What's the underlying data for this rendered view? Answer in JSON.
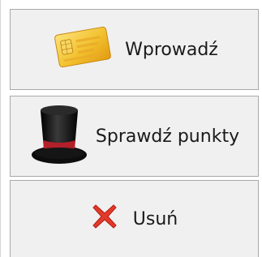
{
  "buttons": {
    "enter_label": "Wprowadź",
    "check_points_label": "Sprawdź punkty",
    "delete_label": "Usuń"
  },
  "icons": {
    "enter": "card-icon",
    "check_points": "top-hat-icon",
    "delete": "red-x-icon"
  },
  "colors": {
    "button_bg": "#f0f0f0",
    "button_border": "#a9a9a9",
    "delete_icon": "#e23a2a",
    "card_gold": "#f2c12e",
    "hat_black": "#1b1b1b",
    "hat_band": "#b3202a"
  }
}
